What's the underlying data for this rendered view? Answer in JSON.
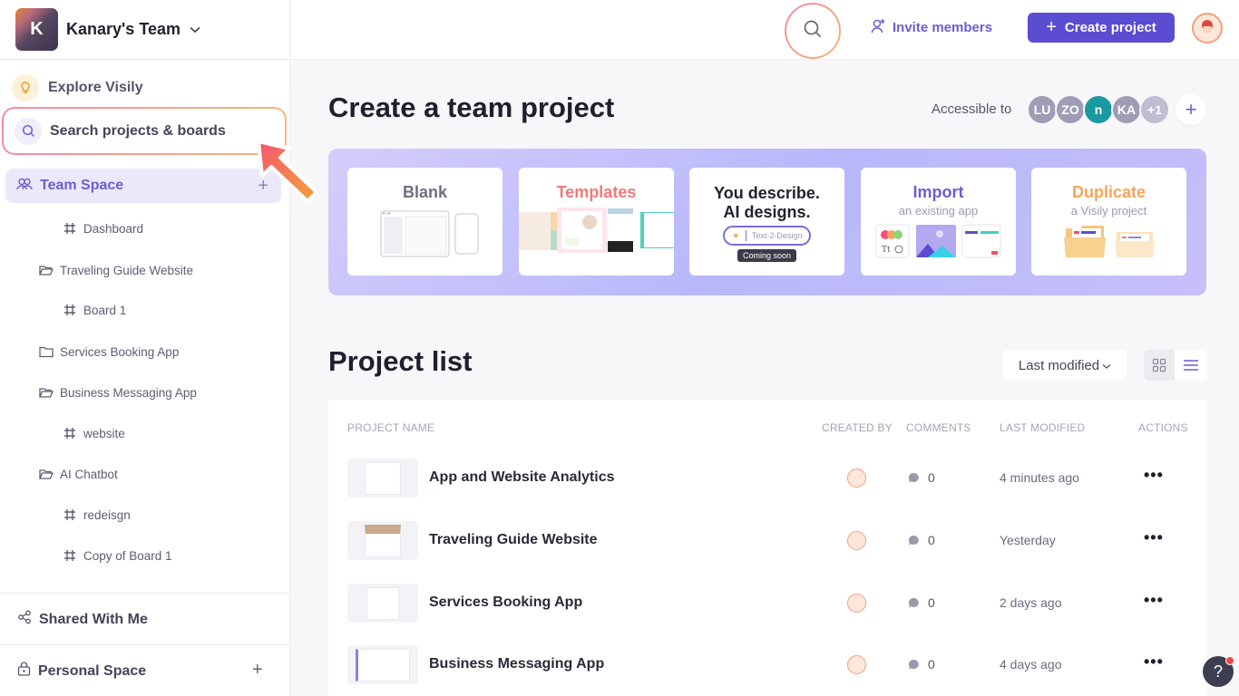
{
  "team": {
    "logo_letter": "K",
    "name": "Kanary's Team"
  },
  "sidebar": {
    "explore_label": "Explore Visily",
    "search_label": "Search projects & boards",
    "team_space_label": "Team Space",
    "tree": [
      {
        "type": "board",
        "label": "Dashboard",
        "level": 2
      },
      {
        "type": "folder-open",
        "label": "Traveling Guide Website",
        "level": 1
      },
      {
        "type": "board",
        "label": "Board 1",
        "level": 2
      },
      {
        "type": "folder",
        "label": "Services Booking App",
        "level": 1
      },
      {
        "type": "folder-open",
        "label": "Business Messaging App",
        "level": 1
      },
      {
        "type": "board",
        "label": "website",
        "level": 2
      },
      {
        "type": "folder-open",
        "label": "AI Chatbot",
        "level": 1
      },
      {
        "type": "board",
        "label": "redeisgn",
        "level": 2
      },
      {
        "type": "board",
        "label": "Copy of Board 1",
        "level": 2
      }
    ],
    "shared_label": "Shared With Me",
    "personal_label": "Personal Space"
  },
  "topbar": {
    "invite_label": "Invite members",
    "create_label": "Create project"
  },
  "create_section": {
    "title": "Create a team project",
    "accessible_label": "Accessible to",
    "members": [
      {
        "initials": "LU",
        "color": "#a09cb5"
      },
      {
        "initials": "ZO",
        "color": "#a09cb5"
      },
      {
        "initials": "n",
        "color": "#1a9aa0"
      },
      {
        "initials": "KA",
        "color": "#a09cb5"
      },
      {
        "initials": "+1",
        "color": "#c0bcd2"
      }
    ],
    "cards": [
      {
        "title": "Blank",
        "subtitle": "",
        "color": "#6e6e80"
      },
      {
        "title": "Templates",
        "subtitle": "",
        "color": "#f07a7a"
      },
      {
        "title": "You describe.\nAI designs.",
        "subtitle": "",
        "color": "#22222e",
        "input_label": "Text-2-Design",
        "badge": "Coming soon"
      },
      {
        "title": "Import",
        "subtitle": "an existing app",
        "color": "#6a5fd0"
      },
      {
        "title": "Duplicate",
        "subtitle": "a Visily project",
        "color": "#f5a55a"
      }
    ]
  },
  "project_list": {
    "title": "Project list",
    "sort_label": "Last modified",
    "columns": {
      "name": "PROJECT NAME",
      "created_by": "CREATED BY",
      "comments": "COMMENTS",
      "last_modified": "LAST MODIFIED",
      "actions": "ACTIONS"
    },
    "rows": [
      {
        "name": "App and Website Analytics",
        "comments": "0",
        "modified": "4 minutes ago"
      },
      {
        "name": "Traveling Guide Website",
        "comments": "0",
        "modified": "Yesterday"
      },
      {
        "name": "Services Booking App",
        "comments": "0",
        "modified": "2 days ago"
      },
      {
        "name": "Business Messaging App",
        "comments": "0",
        "modified": "4 days ago"
      }
    ],
    "actions_glyph": "•••"
  },
  "help": {
    "label": "?"
  },
  "colors": {
    "accent": "#5b4dd1",
    "accent_text": "#6a5fd0",
    "highlight_gradient_start": "#f58aa0",
    "highlight_gradient_end": "#f6b57a"
  }
}
